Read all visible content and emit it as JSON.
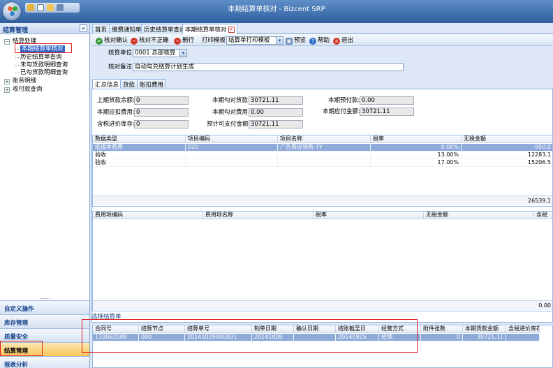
{
  "window": {
    "title": "本期结算单核对 - Bizcent SRP"
  },
  "left_panel": {
    "header": "结算管理",
    "collapse_label": "«",
    "tree": [
      {
        "label": "结算处理",
        "level": 0,
        "toggle": "−"
      },
      {
        "label": "本期结算单核对",
        "level": 1,
        "selected": true
      },
      {
        "label": "历史结算单查询",
        "level": 1
      },
      {
        "label": "未勾货款明细查询",
        "level": 1
      },
      {
        "label": "已勾货款明细查询",
        "level": 1
      },
      {
        "label": "账务明细",
        "level": 0,
        "toggle": "+"
      },
      {
        "label": "收付款查询",
        "level": 0,
        "toggle": "+"
      }
    ],
    "dots": "......",
    "accordion": [
      "自定义操作",
      "库存管理",
      "质量安全",
      "结算管理",
      "报表分析"
    ],
    "active_accordion": "结算管理"
  },
  "tabs": [
    {
      "label": "首页"
    },
    {
      "label": "缴费通知单"
    },
    {
      "label": "历史结算单查询"
    },
    {
      "label": "本期结算单核对",
      "active": true,
      "close": "×"
    }
  ],
  "toolbar": {
    "confirm": "核对确认",
    "incorrect": "核对不正确",
    "delete": "删行",
    "print_template_label": "打印模板",
    "print_template_value": "结算单打印模板",
    "preview": "预览",
    "help": "帮助",
    "exit": "退出"
  },
  "form": {
    "unit_label": "核算单位:",
    "unit_value": "0001 总部核算",
    "remark_label": "核对备注:",
    "remark_value": "自动勾兑结算计划生成"
  },
  "inner_tabs": [
    "汇总信息",
    "货款",
    "账扣费用"
  ],
  "summary": {
    "prev_balance_label": "上期货款余额:",
    "prev_balance": "0",
    "prev_fee_label": "本期应扣费用:",
    "prev_fee": "0",
    "stock_label": "含税进价库存:",
    "stock": "0",
    "matched_goods_label": "本期勾对货款:",
    "matched_goods": "30721.11",
    "matched_fee_label": "本期勾对费用:",
    "matched_fee": "0.00",
    "payable_label": "预计可支付金额:",
    "payable": "30721.11",
    "prepaid_label": "本期预付款:",
    "prepaid": "0.00",
    "should_pay_label": "本期应付金额:",
    "should_pay": "30721.11"
  },
  "grid1": {
    "columns": [
      "数据类型",
      "项目编码",
      "项目名称",
      "税率",
      "无税金额"
    ],
    "rows": [
      [
        "抵成本费用",
        "020",
        "广告费促销费-TY",
        "0.00%",
        "-950.0"
      ],
      [
        "验收",
        "",
        "",
        "13.00%",
        "12283.1"
      ],
      [
        "验收",
        "",
        "",
        "17.00%",
        "15206.5"
      ]
    ],
    "total": "26539.1"
  },
  "grid2": {
    "columns": [
      "费用项编码",
      "费用项名称",
      "税率",
      "无税金额",
      "含税"
    ],
    "total": "0.00"
  },
  "select_panel": {
    "title": "选择结算单",
    "columns": [
      "合同号",
      "结算节点",
      "结算单号",
      "制单日期",
      "确认日期",
      "结账截至日",
      "经营方式",
      "附件张数",
      "本期货款金额",
      "含税进价库存"
    ],
    "rows": [
      [
        "110062008",
        "000",
        "20141009000031",
        "20141009",
        "",
        "20140925",
        "经销",
        "0",
        "30721.11",
        ""
      ]
    ]
  },
  "colors": {
    "accent": "#15428b",
    "selected_row": "#8eaad9",
    "highlight": "#e02020"
  }
}
